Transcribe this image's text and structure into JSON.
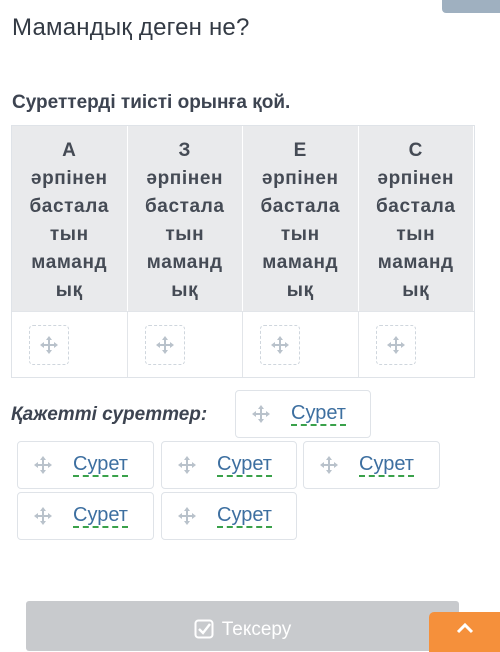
{
  "page": {
    "title": "Мамандық деген не?",
    "instruction": "Суреттерді тиісті орынға қой."
  },
  "columns": [
    {
      "header_lines": [
        "А",
        "әрпінен",
        "бастала",
        "тын",
        "маманд",
        "ық"
      ]
    },
    {
      "header_lines": [
        "З",
        "әрпінен",
        "бастала",
        "тын",
        "маманд",
        "ық"
      ]
    },
    {
      "header_lines": [
        "Е",
        "әрпінен",
        "бастала",
        "тын",
        "маманд",
        "ық"
      ]
    },
    {
      "header_lines": [
        "С",
        "әрпінен",
        "бастала",
        "тын",
        "маманд",
        "ық"
      ]
    }
  ],
  "pool": {
    "label": "Қажетті суреттер:",
    "items": [
      "Сурет",
      "Сурет",
      "Сурет",
      "Сурет",
      "Сурет",
      "Сурет"
    ]
  },
  "actions": {
    "check_label": "Тексеру"
  },
  "icons": {
    "drop_slot": "move-icon",
    "chip": "move-icon",
    "check": "check-square-icon",
    "scroll_top": "chevron-up-icon"
  },
  "colors": {
    "header_bg": "#e9eaec",
    "chip_text": "#3d6fa0",
    "chip_underline": "#3aa14a",
    "check_button_bg": "#c8cacd",
    "scroll_button_bg": "#f5903b"
  }
}
